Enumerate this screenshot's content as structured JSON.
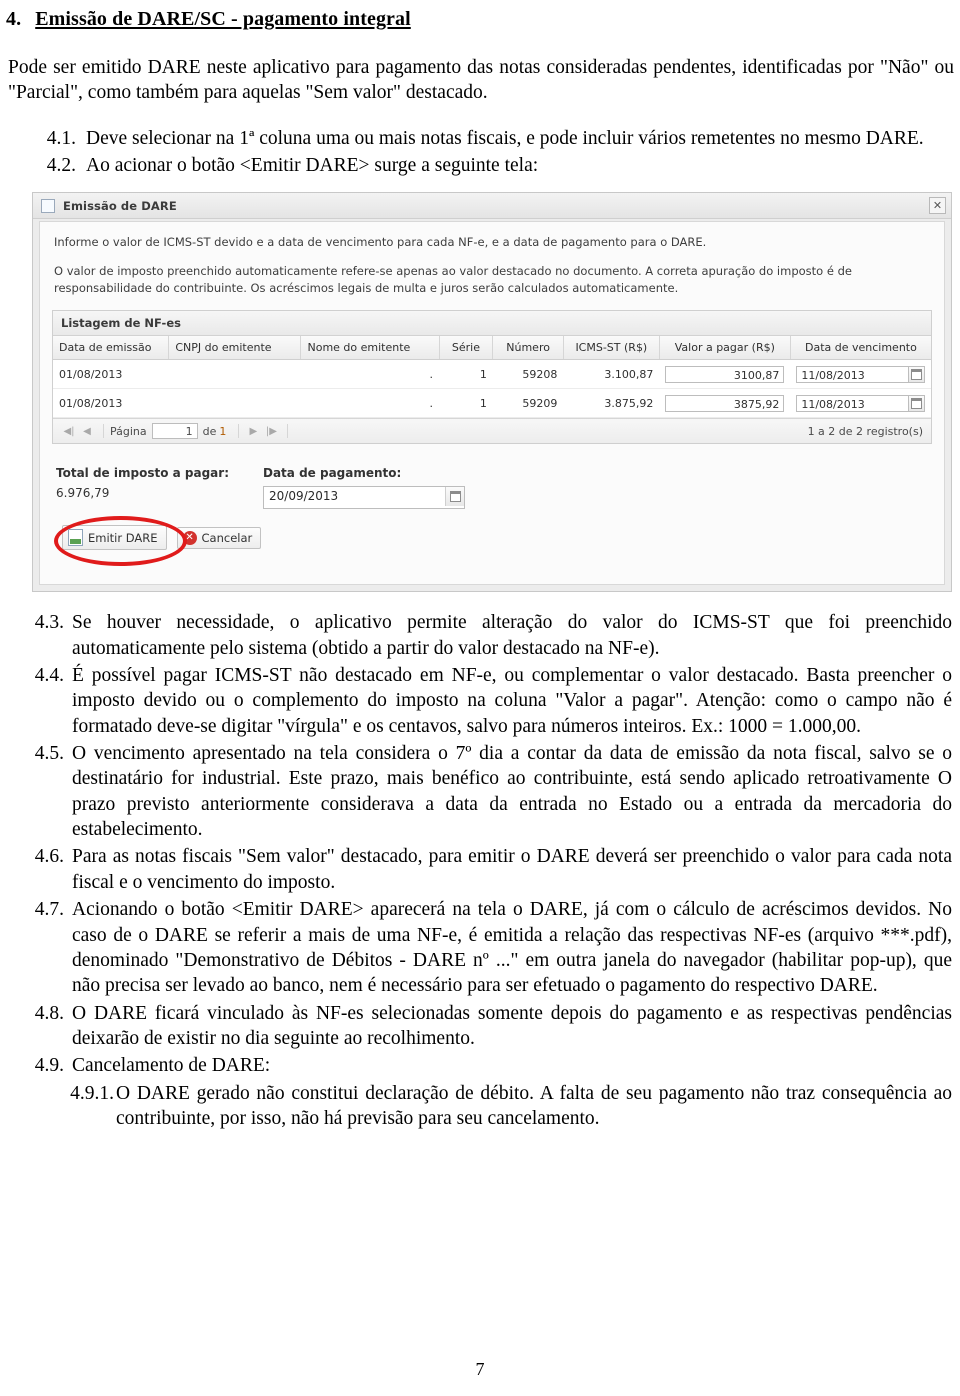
{
  "heading": {
    "number": "4.",
    "text": "Emissão de DARE/SC - pagamento integral"
  },
  "intro": "Pode ser emitido DARE neste aplicativo para pagamento das notas consideradas pendentes, identificadas por \"Não\" ou \"Parcial\", como também para aquelas \"Sem valor\" destacado.",
  "items_before": [
    {
      "marker": "4.1.",
      "text": "Deve selecionar na 1ª coluna uma ou mais notas fiscais, e pode incluir vários remetentes no mesmo DARE."
    },
    {
      "marker": "4.2.",
      "text": "Ao acionar o botão <Emitir DARE> surge a seguinte tela:"
    }
  ],
  "screenshot": {
    "window_title": "Emissão de DARE",
    "close_label": "✕",
    "note_1": "Informe o valor de ICMS-ST devido e a data de vencimento para cada NF-e, e a data de pagamento para o DARE.",
    "note_2": "O valor de imposto preenchido automaticamente refere-se apenas ao valor destacado no documento. A correta apuração do imposto é de responsabilidade do contribuinte. Os acréscimos legais de multa e juros serão calculados automaticamente.",
    "grid_caption": "Listagem de NF-es",
    "columns": [
      "Data de emissão",
      "CNPJ do emitente",
      "Nome do emitente",
      "Série",
      "Número",
      "ICMS-ST (R$)",
      "Valor a pagar (R$)",
      "Data de vencimento"
    ],
    "rows": [
      {
        "data_emissao": "01/08/2013",
        "cnpj": "",
        "nome": ".",
        "serie": "1",
        "numero": "59208",
        "icms_st": "3.100,87",
        "valor_a_pagar": "3100,87",
        "data_vencimento": "11/08/2013"
      },
      {
        "data_emissao": "01/08/2013",
        "cnpj": "",
        "nome": ".",
        "serie": "1",
        "numero": "59209",
        "icms_st": "3.875,92",
        "valor_a_pagar": "3875,92",
        "data_vencimento": "11/08/2013"
      }
    ],
    "pager": {
      "first_glyph": "◀|",
      "prev_glyph": "◀",
      "page_label": "Página",
      "page_value": "1",
      "of_label": "de",
      "total_pages": "1",
      "next_glyph": "▶",
      "last_glyph": "|▶",
      "records": "1 a 2 de 2 registro(s)"
    },
    "totals": {
      "total_label": "Total de imposto a pagar:",
      "total_value": "6.976,79",
      "payment_date_label": "Data de pagamento:",
      "payment_date_value": "20/09/2013"
    },
    "buttons": {
      "emit_label": "Emitir DARE",
      "cancel_label": "Cancelar",
      "cancel_glyph": "✕"
    }
  },
  "items_after": [
    {
      "marker": "4.3.",
      "text": "Se houver necessidade, o aplicativo permite alteração do valor do ICMS-ST que foi preenchido automaticamente pelo sistema (obtido a partir do valor destacado na NF-e)."
    },
    {
      "marker": "4.4.",
      "text": "É possível pagar ICMS-ST não destacado em NF-e, ou complementar o valor destacado. Basta preencher o imposto devido ou o complemento do imposto na coluna \"Valor a pagar\". Atenção: como o campo não é formatado deve-se digitar \"vírgula\" e os centavos, salvo para números inteiros. Ex.: 1000 = 1.000,00."
    },
    {
      "marker": "4.5.",
      "text": "O vencimento apresentado na tela considera o 7º dia a contar da data de emissão da nota fiscal, salvo se o destinatário for industrial. Este prazo, mais benéfico ao contribuinte, está sendo aplicado retroativamente O prazo previsto anteriormente considerava a data da entrada no Estado ou a entrada da mercadoria do estabelecimento."
    },
    {
      "marker": "4.6.",
      "text": "Para as notas fiscais \"Sem valor\" destacado, para emitir o DARE deverá ser preenchido o valor para cada nota fiscal e o vencimento do imposto."
    },
    {
      "marker": "4.7.",
      "text": "Acionando o botão <Emitir DARE> aparecerá na tela o DARE, já com o cálculo de acréscimos devidos. No caso de o DARE se referir a mais de uma NF-e, é emitida a relação das respectivas NF-es (arquivo ***.pdf), denominado \"Demonstrativo de Débitos - DARE nº ...\"  em outra janela do navegador (habilitar pop-up), que não precisa ser levado ao banco, nem é necessário para ser efetuado o pagamento do respectivo DARE."
    },
    {
      "marker": "4.8.",
      "text": "O DARE ficará vinculado às NF-es selecionadas somente depois do pagamento e as respectivas pendências deixarão de existir no dia seguinte ao recolhimento."
    },
    {
      "marker": "4.9.",
      "text": "Cancelamento de DARE:"
    }
  ],
  "subitem": {
    "marker": "4.9.1.",
    "text": "O DARE gerado não constitui declaração de débito. A falta de seu pagamento não traz consequência ao contribuinte, por isso, não há previsão para seu cancelamento."
  },
  "footer": {
    "page_number": "7"
  }
}
